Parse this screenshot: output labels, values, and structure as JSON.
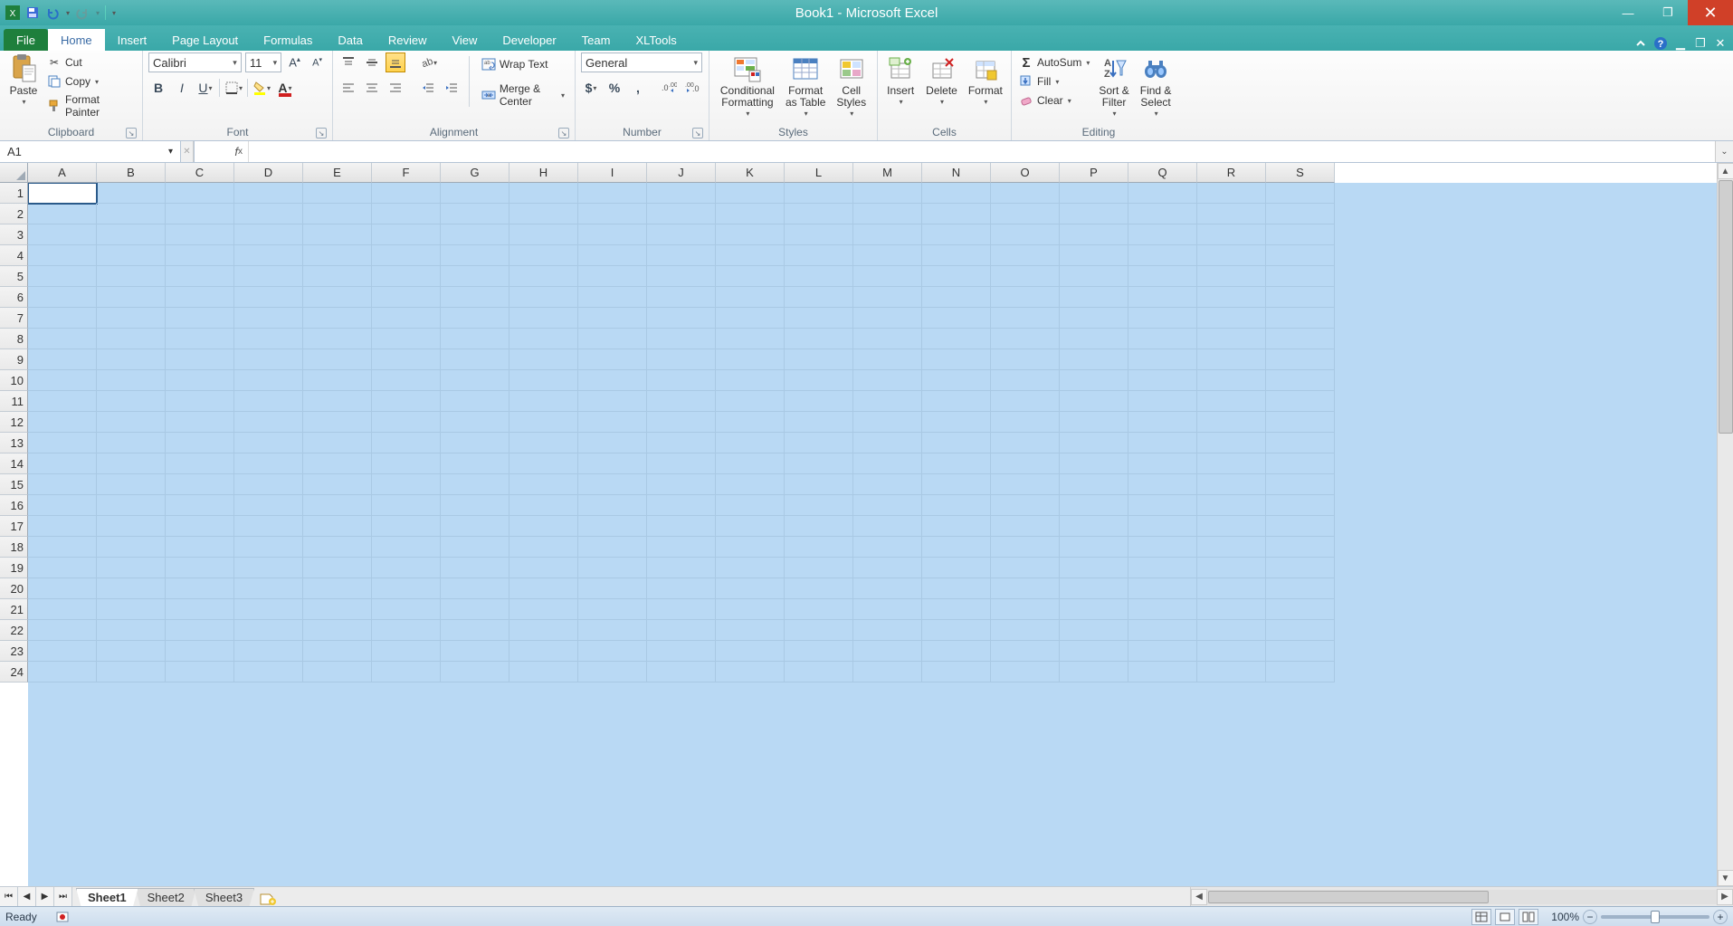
{
  "title": "Book1 - Microsoft Excel",
  "qat": {
    "save": "save",
    "undo": "undo",
    "redo": "redo"
  },
  "tabs": {
    "file": "File",
    "home": "Home",
    "insert": "Insert",
    "pagelayout": "Page Layout",
    "formulas": "Formulas",
    "data": "Data",
    "review": "Review",
    "view": "View",
    "developer": "Developer",
    "team": "Team",
    "xltools": "XLTools"
  },
  "ribbon": {
    "clipboard": {
      "label": "Clipboard",
      "paste": "Paste",
      "cut": "Cut",
      "copy": "Copy",
      "formatpainter": "Format Painter"
    },
    "font": {
      "label": "Font",
      "name": "Calibri",
      "size": "11"
    },
    "alignment": {
      "label": "Alignment",
      "wrap": "Wrap Text",
      "merge": "Merge & Center"
    },
    "number": {
      "label": "Number",
      "format": "General"
    },
    "styles": {
      "label": "Styles",
      "cond": "Conditional\nFormatting",
      "table": "Format\nas Table",
      "cell": "Cell\nStyles"
    },
    "cells": {
      "label": "Cells",
      "insert": "Insert",
      "delete": "Delete",
      "format": "Format"
    },
    "editing": {
      "label": "Editing",
      "autosum": "AutoSum",
      "fill": "Fill",
      "clear": "Clear",
      "sort": "Sort &\nFilter",
      "find": "Find &\nSelect"
    }
  },
  "namebox": "A1",
  "columns": [
    "A",
    "B",
    "C",
    "D",
    "E",
    "F",
    "G",
    "H",
    "I",
    "J",
    "K",
    "L",
    "M",
    "N",
    "O",
    "P",
    "Q",
    "R",
    "S"
  ],
  "rows": [
    "1",
    "2",
    "3",
    "4",
    "5",
    "6",
    "7",
    "8",
    "9",
    "10",
    "11",
    "12",
    "13",
    "14",
    "15",
    "16",
    "17",
    "18",
    "19",
    "20",
    "21",
    "22",
    "23",
    "24"
  ],
  "sheets": {
    "s1": "Sheet1",
    "s2": "Sheet2",
    "s3": "Sheet3"
  },
  "status": {
    "ready": "Ready",
    "zoom": "100%"
  }
}
